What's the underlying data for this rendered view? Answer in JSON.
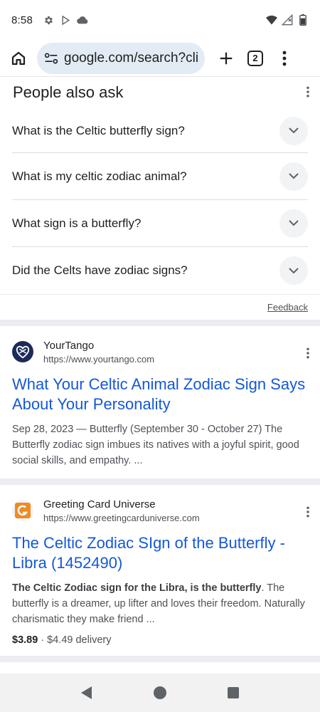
{
  "status_bar": {
    "time": "8:58"
  },
  "toolbar": {
    "url": "google.com/search?client=ms-android",
    "tab_count": "2"
  },
  "paa": {
    "title": "People also ask",
    "questions": [
      "What is the Celtic butterfly sign?",
      "What is my celtic zodiac animal?",
      "What sign is a butterfly?",
      "Did the Celts have zodiac signs?"
    ],
    "feedback": "Feedback"
  },
  "results": [
    {
      "site_name": "YourTango",
      "site_url": "https://www.yourtango.com",
      "title": "What Your Celtic Animal Zodiac Sign Says About Your Personality",
      "snippet": "Sep 28, 2023 — Butterfly (September 30 - October 27) The Butterfly zodiac sign imbues its natives with a joyful spirit, good social skills, and empathy. ..."
    },
    {
      "site_name": "Greeting Card Universe",
      "site_url": "https://www.greetingcarduniverse.com",
      "title": "The Celtic Zodiac SIgn of the Butterfly - Libra (1452490)",
      "snippet_bold": "The Celtic Zodiac sign for the Libra, is the butterfly",
      "snippet_rest": ". The butterfly is a dreamer, up lifter and loves their freedom. Naturally charismatic they make friend ...",
      "price": "$3.89",
      "delivery": " · $4.49 delivery"
    }
  ],
  "colors": {
    "link_blue": "#1a0dab",
    "omnibox_bg": "#e3ecf4",
    "yourtango_favicon": "#1c2a5a",
    "gcu_favicon": "#f08a24"
  },
  "icons": {
    "status": [
      "gear-icon",
      "play-store-icon",
      "cloud-icon",
      "wifi-icon",
      "signal-icon",
      "battery-icon"
    ],
    "toolbar": [
      "home-icon",
      "site-settings-icon",
      "plus-icon",
      "tab-switcher-icon",
      "more-vert-icon"
    ],
    "nav": [
      "back-icon",
      "home-circle-icon",
      "recents-icon"
    ]
  }
}
